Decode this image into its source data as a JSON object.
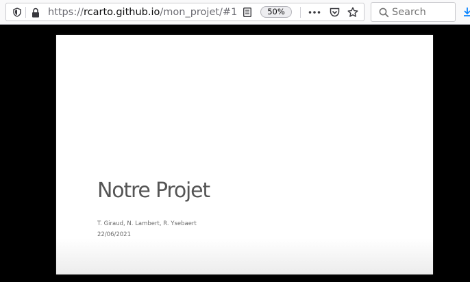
{
  "browser": {
    "url_prefix": "https://",
    "url_host": "rcarto.github.io",
    "url_path": "/mon_projet/#1",
    "zoom_level": "50%",
    "search_placeholder": "Search"
  },
  "slide": {
    "title": "Notre Projet",
    "authors": "T. Giraud, N. Lambert, R. Ysebaert",
    "date": "22/06/2021"
  },
  "colors": {
    "page_background": "#000000",
    "slide_background": "#ffffff",
    "title_text": "#555555",
    "toolbar_background": "#f9f9fa",
    "download_accent": "#0a84ff"
  },
  "icons": [
    "tracking-protection-shield-icon",
    "lock-icon",
    "reader-view-icon",
    "page-actions-icon",
    "pocket-icon",
    "bookmark-star-icon",
    "search-icon",
    "download-icon"
  ]
}
